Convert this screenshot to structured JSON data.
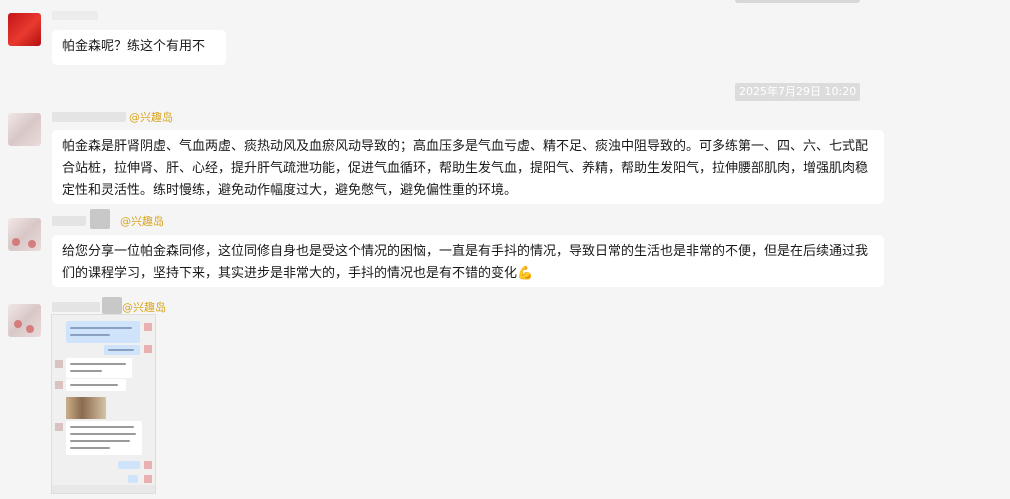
{
  "messages": [
    {
      "text": "帕金森呢？练这个有用不"
    },
    {
      "sender": "@兴趣岛",
      "text": "帕金森是肝肾阴虚、气血两虚、痰热动风及血瘀风动导致的；高血压多是气血亏虚、精不足、痰浊中阻导致的。可多练第一、四、六、七式配合站桩，拉伸肾、肝、心经，提升肝气疏泄功能，促进气血循环，帮助生发气血，提阳气、养精，帮助生发阳气，拉伸腰部肌肉，增强肌肉稳定性和灵活性。练时慢练，避免动作幅度过大，避免憋气，避免偏性重的环境。"
    },
    {
      "sender": "@兴趣岛",
      "text": "给您分享一位帕金森同修，这位同修自身也是受这个情况的困恼，一直是有手抖的情况，导致日常的生活也是非常的不便，但是在后续通过我们的课程学习，坚持下来，其实进步是非常大的，手抖的情况也是有不错的变化",
      "emoji": "💪"
    },
    {
      "sender": "@兴趣岛"
    }
  ],
  "timestamp": "2025年7月29日 10:20",
  "icons": {
    "emoji": "flexed-biceps-icon"
  },
  "colors": {
    "background": "#f5f5f5",
    "bubble": "#ffffff",
    "sender": "#d9a520",
    "timestamp_bg": "#dcdcdc"
  }
}
